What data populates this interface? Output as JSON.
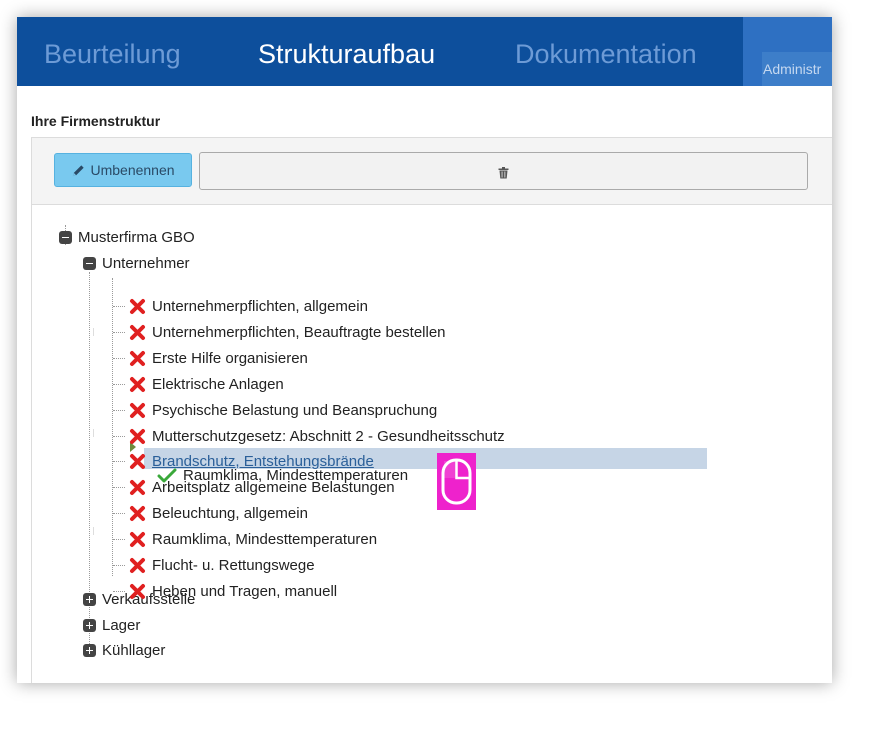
{
  "nav": {
    "tabs": [
      {
        "label": "Beurteilung",
        "active": false
      },
      {
        "label": "Strukturaufbau",
        "active": true
      },
      {
        "label": "Dokumentation",
        "active": false
      }
    ],
    "admin_label": "Administr"
  },
  "section_title": "Ihre Firmenstruktur",
  "toolbar": {
    "rename_label": "Umbenennen",
    "rename_icon": "pencil-icon",
    "delete_icon": "trash-icon"
  },
  "tree": {
    "root": {
      "label": "Musterfirma GBO",
      "expanded": true
    },
    "groups": [
      {
        "label": "Unternehmer",
        "expanded": true
      },
      {
        "label": "Verkaufsstelle",
        "expanded": false
      },
      {
        "label": "Lager",
        "expanded": false
      },
      {
        "label": "Kühllager",
        "expanded": false
      }
    ],
    "items": [
      "Unternehmerpflichten, allgemein",
      "Unternehmerpflichten, Beauftragte bestellen",
      "Erste Hilfe organisieren",
      "Elektrische Anlagen",
      "Psychische Belastung und Beanspruchung",
      "Mutterschutzgesetz: Abschnitt 2 - Gesundheitsschutz",
      "Brandschutz, Entstehungsbrände",
      "Arbeitsplatz allgemeine Belastungen",
      "Beleuchtung, allgemein",
      "Raumklima, Mindesttemperaturen",
      "Flucht- u. Rettungswege",
      "Heben und Tragen, manuell"
    ],
    "selected_index": 6,
    "drag_ghost_label": "Raumklima, Mindesttemperaturen"
  },
  "colors": {
    "nav_bg": "#0d4f9c",
    "nav_active": "#ffffff",
    "nav_inactive": "#6d9bd6",
    "button_blue": "#79c9ef",
    "selection": "#c6d5e6",
    "delete_icon_red": "#e02020",
    "check_green": "#3aa83a",
    "cursor_overlay": "#ee22cc"
  }
}
